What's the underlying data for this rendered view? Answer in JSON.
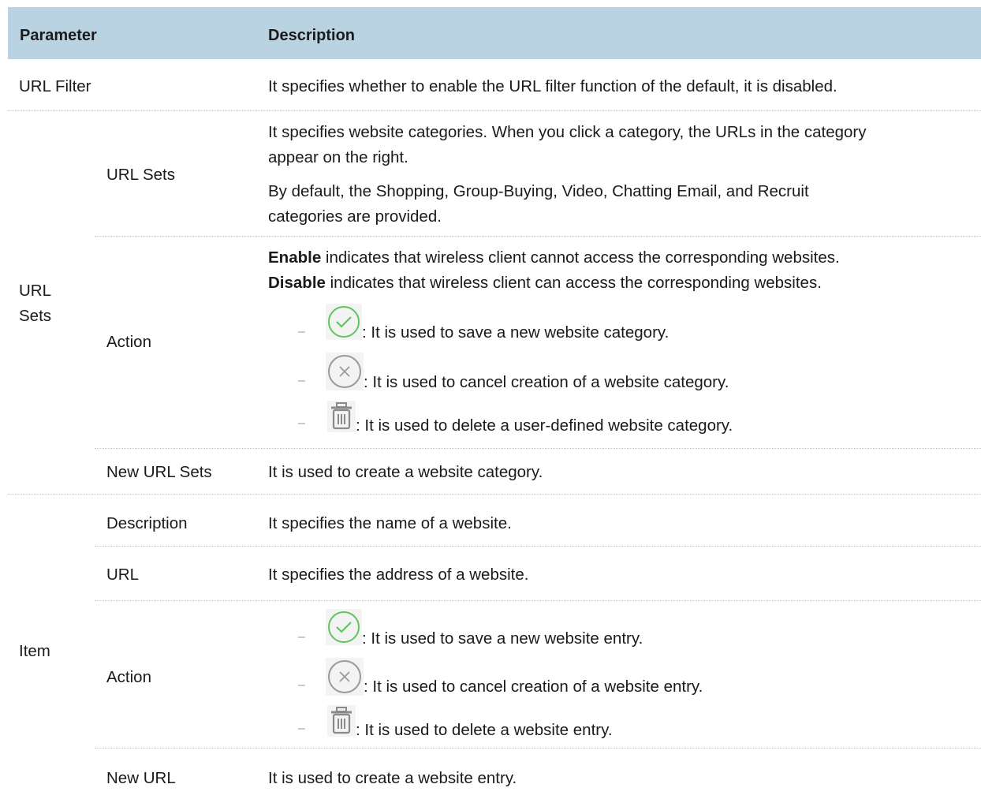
{
  "table": {
    "header": {
      "parameter": "Parameter",
      "description": "Description"
    },
    "url_filter": {
      "param": "URL Filter",
      "desc": "It specifies whether to enable the URL filter function of the default, it is disabled."
    },
    "url_sets_group": {
      "label_line1": "URL",
      "label_line2": "Sets",
      "url_sets": {
        "param": "URL Sets",
        "desc_line1": "It specifies website categories. When you click a category, the URLs in the category",
        "desc_line2": "appear on the right.",
        "desc_line3": "By default, the Shopping, Group-Buying, Video, Chatting Email, and Recruit",
        "desc_line4": "categories are provided."
      },
      "action": {
        "param": "Action",
        "enable_bold": "Enable",
        "enable_rest": " indicates that wireless client cannot access the corresponding websites.",
        "disable_bold": "Disable",
        "disable_rest": " indicates that wireless client can access the corresponding websites.",
        "bullets": [
          {
            "icon": "check-circle-icon",
            "text": ": It is used to save a new website category."
          },
          {
            "icon": "x-circle-icon",
            "text": ": It is used to cancel creation of a website category."
          },
          {
            "icon": "trash-icon",
            "text": ": It is used to delete a user-defined website category."
          }
        ]
      },
      "new_url_sets": {
        "param": "New URL Sets",
        "desc": "It is used to create a website category."
      }
    },
    "item_group": {
      "label": "Item",
      "description": {
        "param": "Description",
        "desc": "It specifies the name of a website."
      },
      "url": {
        "param": "URL",
        "desc": "It specifies the address of a website."
      },
      "action": {
        "param": "Action",
        "bullets": [
          {
            "icon": "check-circle-icon",
            "text": ": It is used to save a new website entry."
          },
          {
            "icon": "x-circle-icon",
            "text": ": It is used to cancel creation of a website entry."
          },
          {
            "icon": "trash-icon",
            "text": ": It is used to delete a website entry."
          }
        ]
      },
      "new_url": {
        "param": "New URL",
        "desc": "It is used to create a website entry."
      }
    },
    "dash_char": "–",
    "colors": {
      "header_bg": "#b9d3e2",
      "check_green": "#5fc55f",
      "cancel_gray": "#9a9a9a"
    }
  }
}
